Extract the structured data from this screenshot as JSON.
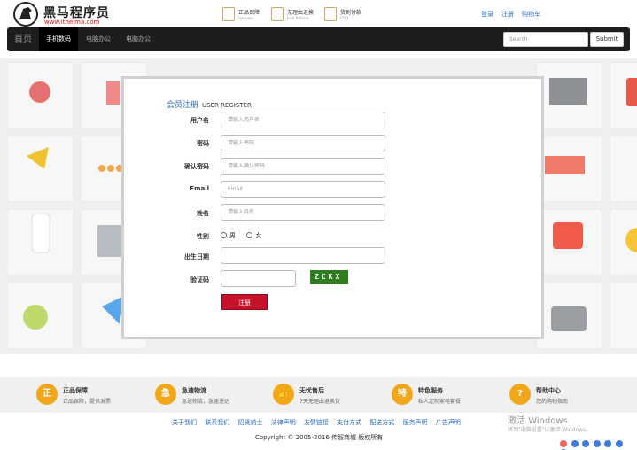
{
  "header": {
    "logo_title": "黑马程序员",
    "logo_url": "www.itheima.com",
    "badges": [
      {
        "title": "正品保障",
        "sub": "Genuine"
      },
      {
        "title": "无理由退换",
        "sub": "Free Returns"
      },
      {
        "title": "货到付款",
        "sub": "COD"
      }
    ],
    "links": {
      "login": "登录",
      "register": "注册",
      "cart": "购物车"
    }
  },
  "nav": {
    "home": "首页",
    "items": [
      "手机数码",
      "电脑办公",
      "电脑办公"
    ],
    "search_placeholder": "Search",
    "submit": "Submit"
  },
  "form": {
    "title": "会员注册",
    "title_en": "USER REGISTER",
    "fields": {
      "username": {
        "label": "用户名",
        "placeholder": "请输入用户名"
      },
      "password": {
        "label": "密码",
        "placeholder": "请输入密码"
      },
      "confirm": {
        "label": "确认密码",
        "placeholder": "请输入确认密码"
      },
      "email": {
        "label": "Email",
        "placeholder": "Email"
      },
      "name": {
        "label": "姓名",
        "placeholder": "请输入姓名"
      },
      "gender": {
        "label": "性别",
        "male": "男",
        "female": "女"
      },
      "birthday": {
        "label": "出生日期",
        "placeholder": ""
      },
      "captcha": {
        "label": "验证码",
        "placeholder": "",
        "image_text": "ZCKX"
      }
    },
    "submit": "注册"
  },
  "footer": {
    "features": [
      {
        "icon": "正",
        "title": "正品保障",
        "sub": "正品保障，提供发票"
      },
      {
        "icon": "急",
        "title": "急速物流",
        "sub": "急速物流，急速送达"
      },
      {
        "icon": "👍",
        "title": "无忧售后",
        "sub": "7天无理由退换货"
      },
      {
        "icon": "特",
        "title": "特色服务",
        "sub": "私人定制家电套餐"
      },
      {
        "icon": "?",
        "title": "帮助中心",
        "sub": "您的购物指南"
      }
    ],
    "links": [
      "关于我们",
      "联系我们",
      "招贤纳士",
      "法律声明",
      "友情链接",
      "支付方式",
      "配送方式",
      "服务声明",
      "广告声明"
    ],
    "copyright": "Copyright © 2005-2016 传智商城 版权所有"
  },
  "watermark": {
    "title": "激活 Windows",
    "sub": "转到\"电脑设置\"以激活 Windows。"
  }
}
